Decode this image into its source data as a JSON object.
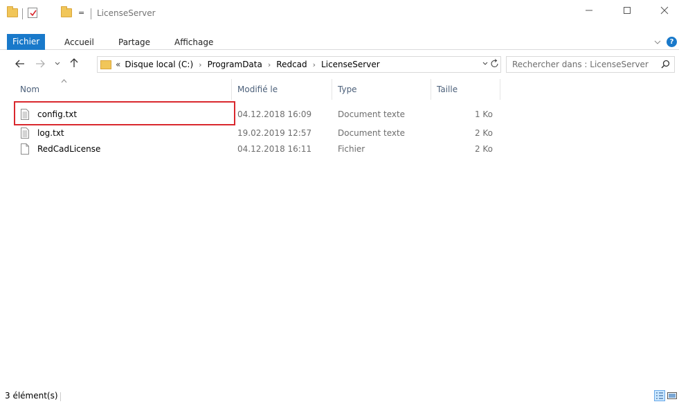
{
  "window": {
    "title": "LicenseServer",
    "quick_access_dropdown": "="
  },
  "ribbon": {
    "tabs": [
      {
        "label": "Fichier",
        "active": true
      },
      {
        "label": "Accueil",
        "active": false
      },
      {
        "label": "Partage",
        "active": false
      },
      {
        "label": "Affichage",
        "active": false
      }
    ],
    "help_label": "?"
  },
  "address_bar": {
    "overflow": "«",
    "breadcrumbs": [
      "Disque local (C:)",
      "ProgramData",
      "Redcad",
      "LicenseServer"
    ]
  },
  "search": {
    "placeholder": "Rechercher dans : LicenseServer"
  },
  "columns": {
    "name": "Nom",
    "modified": "Modifié le",
    "type": "Type",
    "size": "Taille"
  },
  "files": [
    {
      "name": "config.txt",
      "modified": "04.12.2018 16:09",
      "type": "Document texte",
      "size": "1 Ko",
      "icon": "text-file-icon",
      "highlighted": true
    },
    {
      "name": "log.txt",
      "modified": "19.02.2019 12:57",
      "type": "Document texte",
      "size": "2 Ko",
      "icon": "text-file-icon",
      "highlighted": false
    },
    {
      "name": "RedCadLicense",
      "modified": "04.12.2018 16:11",
      "type": "Fichier",
      "size": "2 Ko",
      "icon": "blank-file-icon",
      "highlighted": false
    }
  ],
  "status_bar": {
    "item_count": "3 élément(s)"
  },
  "colors": {
    "accent": "#1979ca",
    "highlight_box": "#d9272d",
    "header_text": "#4c607a"
  }
}
